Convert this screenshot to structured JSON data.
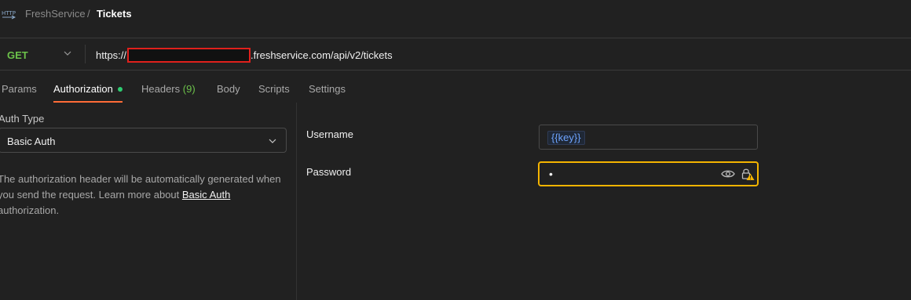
{
  "breadcrumb": {
    "icon": "http-request-icon",
    "parent": "FreshService",
    "separator": "/",
    "current": "Tickets"
  },
  "request": {
    "method": "GET",
    "method_color": "#6cc24a",
    "url_prefix": "https://",
    "url_suffix": ".freshservice.com/api/v2/tickets"
  },
  "tabs": [
    {
      "label": "Params",
      "count": ""
    },
    {
      "label": "Authorization",
      "count": "",
      "active": true,
      "indicator_color": "#2ecc71"
    },
    {
      "label": "Headers",
      "count": "(9)"
    },
    {
      "label": "Body",
      "count": ""
    },
    {
      "label": "Scripts",
      "count": ""
    },
    {
      "label": "Settings",
      "count": ""
    }
  ],
  "auth": {
    "type_label": "Auth Type",
    "type_value": "Basic Auth",
    "description_before": "The authorization header will be automatically generated when you send the request. Learn more about ",
    "description_link": "Basic Auth",
    "description_after": " authorization.",
    "username_label": "Username",
    "username_value": "{{key}}",
    "password_label": "Password",
    "password_value": "•"
  },
  "colors": {
    "accent": "#ff6c37",
    "warning": "#f4b400",
    "variable": "#6ea4ff",
    "redaction": "#e0201c"
  }
}
